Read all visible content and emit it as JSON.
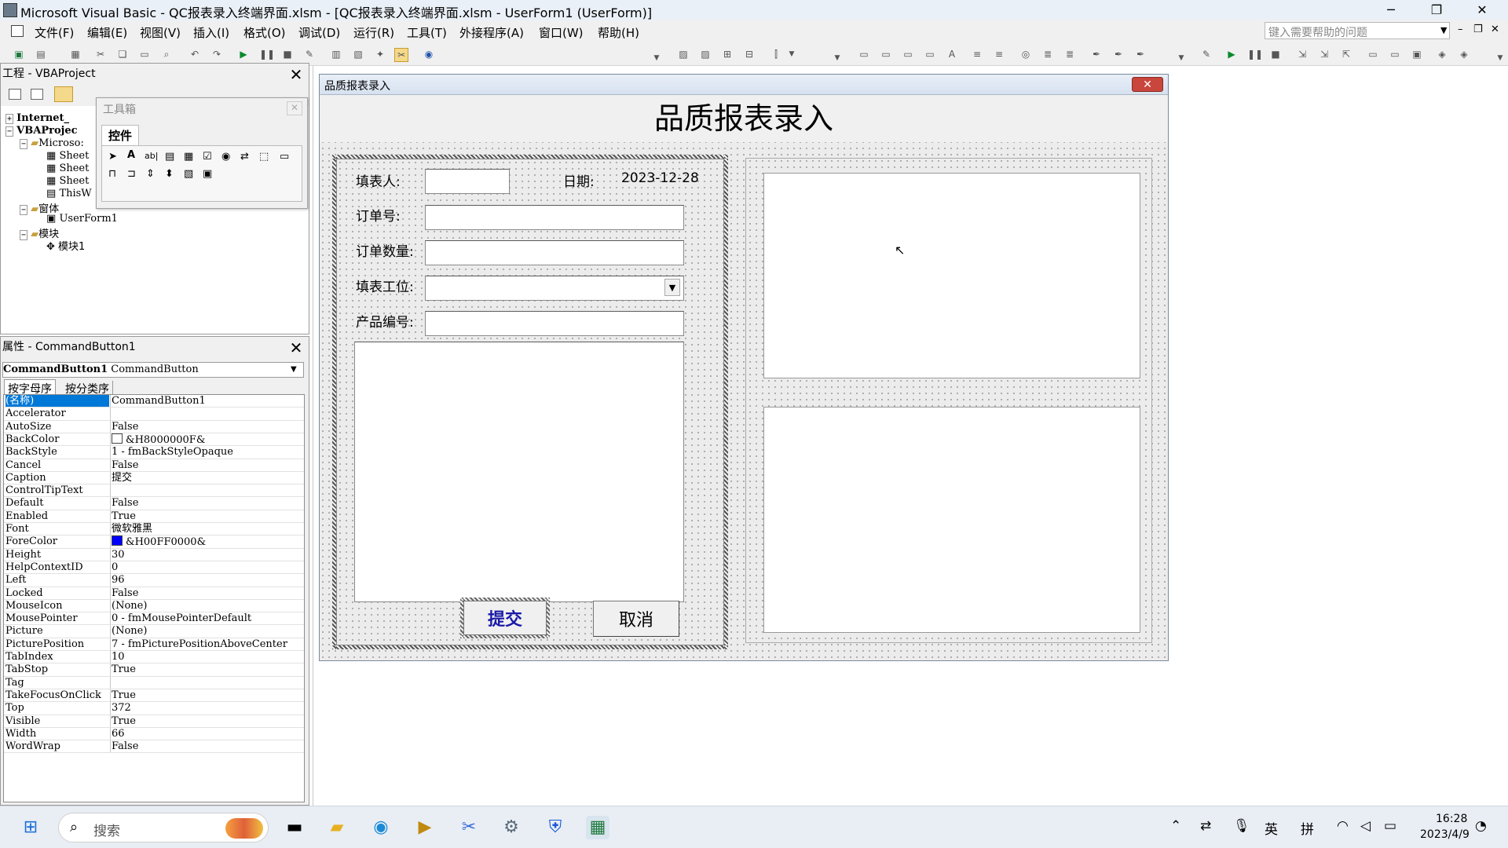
{
  "window": {
    "title": "Microsoft Visual Basic - QC报表录入终端界面.xlsm - [QC报表录入终端界面.xlsm - UserForm1 (UserForm)]",
    "minimize": "─",
    "restore": "❐",
    "close": "✕"
  },
  "menu": [
    "文件(F)",
    "编辑(E)",
    "视图(V)",
    "插入(I)",
    "格式(O)",
    "调试(D)",
    "运行(R)",
    "工具(T)",
    "外接程序(A)",
    "窗口(W)",
    "帮助(H)"
  ],
  "help_placeholder": "键入需要帮助的问题",
  "project": {
    "title": "工程 - VBAProject",
    "tree": [
      {
        "label": "Internet_",
        "indent": 0,
        "bold": true
      },
      {
        "label": "VBAProjec",
        "indent": 0,
        "bold": true
      },
      {
        "label": "Microso:",
        "indent": 1
      },
      {
        "label": "Sheet",
        "indent": 2
      },
      {
        "label": "Sheet",
        "indent": 2
      },
      {
        "label": "Sheet",
        "indent": 2
      },
      {
        "label": "ThisW",
        "indent": 2
      },
      {
        "label": "窗体",
        "indent": 1
      },
      {
        "label": "UserForm1",
        "indent": 2
      },
      {
        "label": "模块",
        "indent": 1
      },
      {
        "label": "模块1",
        "indent": 2
      }
    ]
  },
  "toolbox": {
    "title": "工具箱",
    "tab": "控件"
  },
  "properties": {
    "title": "属性 - CommandButton1",
    "object_name": "CommandButton1",
    "object_type": "CommandButton",
    "tab_alpha": "按字母序",
    "tab_category": "按分类序",
    "rows": [
      [
        "(名称)",
        "CommandButton1"
      ],
      [
        "Accelerator",
        ""
      ],
      [
        "AutoSize",
        "False"
      ],
      [
        "BackColor",
        "&H8000000F&"
      ],
      [
        "BackStyle",
        "1 - fmBackStyleOpaque"
      ],
      [
        "Cancel",
        "False"
      ],
      [
        "Caption",
        "提交"
      ],
      [
        "ControlTipText",
        ""
      ],
      [
        "Default",
        "False"
      ],
      [
        "Enabled",
        "True"
      ],
      [
        "Font",
        "微软雅黑"
      ],
      [
        "ForeColor",
        "&H00FF0000&"
      ],
      [
        "Height",
        "30"
      ],
      [
        "HelpContextID",
        "0"
      ],
      [
        "Left",
        "96"
      ],
      [
        "Locked",
        "False"
      ],
      [
        "MouseIcon",
        "(None)"
      ],
      [
        "MousePointer",
        "0 - fmMousePointerDefault"
      ],
      [
        "Picture",
        "(None)"
      ],
      [
        "PicturePosition",
        "7 - fmPicturePositionAboveCenter"
      ],
      [
        "TabIndex",
        "10"
      ],
      [
        "TabStop",
        "True"
      ],
      [
        "Tag",
        ""
      ],
      [
        "TakeFocusOnClick",
        "True"
      ],
      [
        "Top",
        "372"
      ],
      [
        "Visible",
        "True"
      ],
      [
        "Width",
        "66"
      ],
      [
        "WordWrap",
        "False"
      ]
    ],
    "backcolor_swatch": "#ffffff",
    "forecolor_swatch": "#0000ff",
    "selected_color": "#0078d7"
  },
  "form": {
    "caption": "品质报表录入",
    "heading": "品质报表录入",
    "labels": {
      "filler": "填表人:",
      "date_label": "日期:",
      "date_value": "2023-12-28",
      "order_no": "订单号:",
      "order_qty": "订单数量:",
      "station": "填表工位:",
      "product_no": "产品编号:"
    },
    "submit": "提交",
    "cancel": "取消",
    "submit_color": "#1a1aa8"
  },
  "taskbar": {
    "search": "搜索",
    "ime_lang": "英",
    "ime_mode": "拼",
    "time": "16:28",
    "date": "2023/4/9"
  }
}
